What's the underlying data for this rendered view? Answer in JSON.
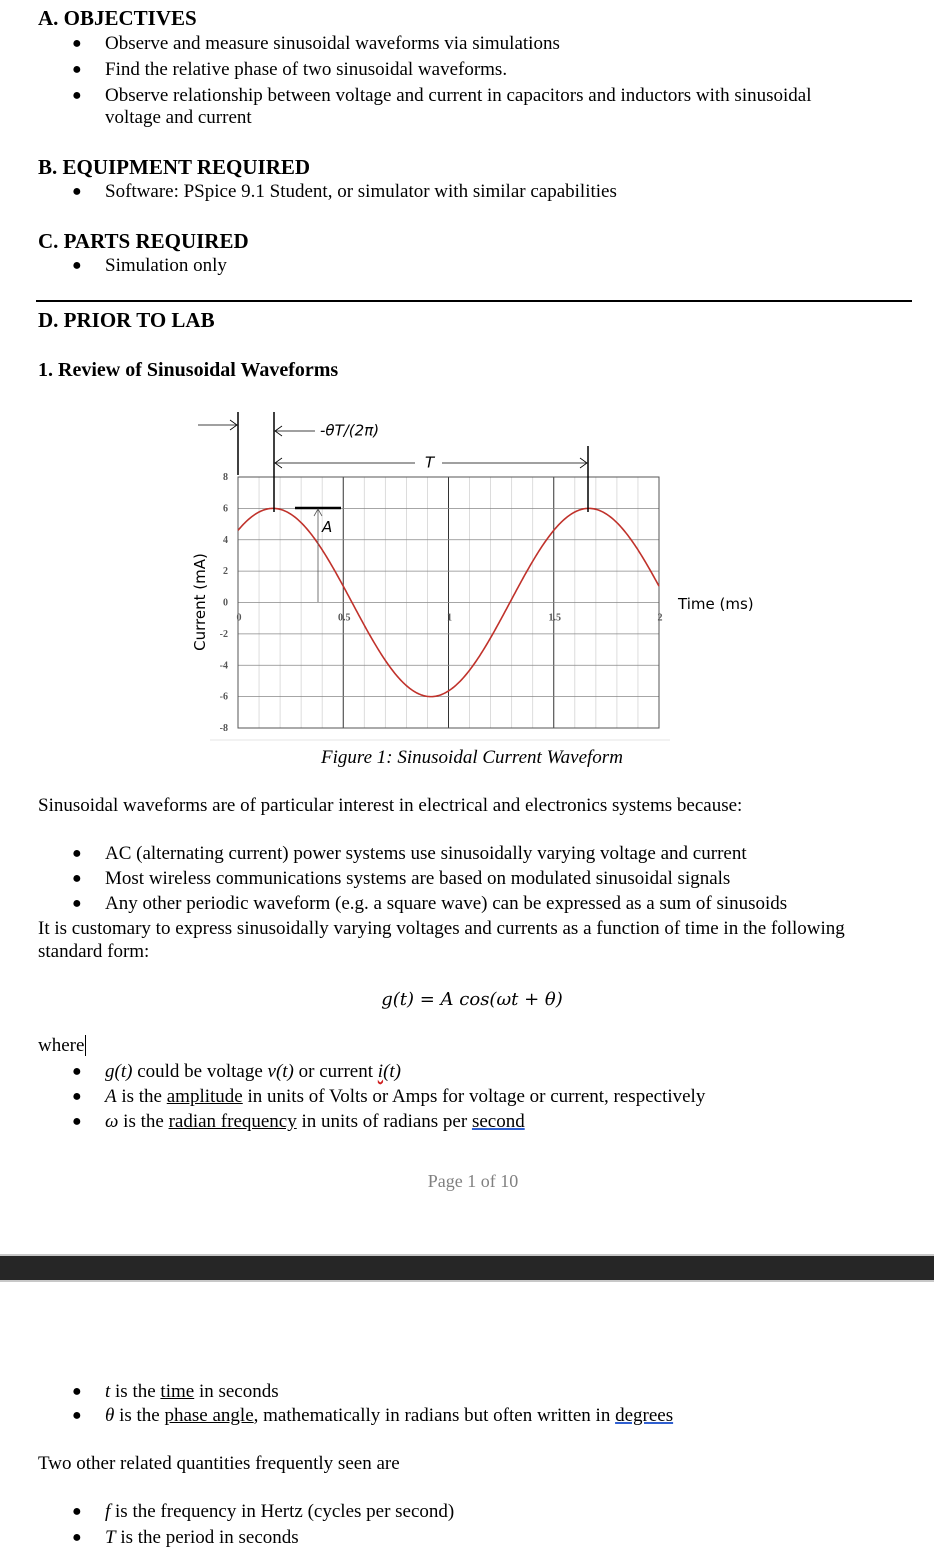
{
  "sections": {
    "a_title": "A. OBJECTIVES",
    "a_items": [
      "Observe and measure sinusoidal waveforms via simulations",
      "Find the relative phase of two sinusoidal waveforms.",
      "Observe relationship between voltage and current in capacitors and inductors with sinusoidal",
      "voltage and current"
    ],
    "b_title": "B.  EQUIPMENT REQUIRED",
    "b_items": [
      "Software:   PSpice 9.1 Student, or simulator with similar capabilities"
    ],
    "c_title": "C. PARTS REQUIRED",
    "c_items": [
      "Simulation only"
    ],
    "d_title": "D. PRIOR TO LAB",
    "sub1_title": "1. Review of Sinusoidal Waveforms"
  },
  "figure": {
    "caption": "Figure 1:   Sinusoidal Current Waveform"
  },
  "chart_data": {
    "type": "line",
    "xlabel": "Time (ms)",
    "ylabel": "Current (mA)",
    "xlim": [
      0,
      2
    ],
    "ylim": [
      -8,
      8
    ],
    "x_ticks": [
      "0",
      "0.5",
      "1",
      "1.5",
      "2"
    ],
    "y_ticks": [
      "8",
      "6",
      "4",
      "2",
      "0",
      "-2",
      "-4",
      "-6",
      "-8"
    ],
    "grid": true,
    "series_color": "#c0322b",
    "series": [
      {
        "amplitude_mA": 6,
        "period_ms": 1.5,
        "phase_deg": -40
      }
    ],
    "annotations": {
      "phase": "-θT/(2π)",
      "period": "T",
      "amplitude": "A"
    }
  },
  "body": {
    "intro": "Sinusoidal waveforms are of particular interest in electrical and electronics systems because:",
    "reasons": [
      "AC (alternating current) power systems use sinusoidally varying voltage and current",
      "Most wireless communications systems are based on modulated sinusoidal signals",
      "Any other periodic waveform (e.g. a square wave) can be expressed as a sum of sinusoids"
    ],
    "custom_1": "It is customary to express sinusoidally varying voltages and currents as a function of time in the following",
    "custom_2": "standard form:",
    "equation": "g(t) = A  cos(ωt + θ)",
    "where": "where",
    "w1": {
      "a": "g(t)",
      "b": " could be voltage ",
      "c": "v(t)",
      "d": " or current ",
      "e": "i",
      "f": "(t)"
    },
    "w2": {
      "a": "A",
      "b": " is the ",
      "c": "amplitude",
      "d": " in units of Volts or Amps for voltage or current, respectively"
    },
    "w3": {
      "a": "ω",
      "b": " is the ",
      "c": "radian frequency",
      "d": " in units of radians per ",
      "e": "second"
    },
    "page_num": "Page  1  of 10",
    "w4": {
      "a": "t",
      "b": " is the ",
      "c": "time",
      "d": " in seconds"
    },
    "w5": {
      "a": "θ",
      "b": " is the ",
      "c": "phase angle",
      "d": ", mathematically in radians but often written in ",
      "e": "degrees"
    },
    "related": "Two other related quantities frequently seen are",
    "w6": {
      "a": "f",
      "b": " is the frequency in Hertz (cycles per second)"
    },
    "w7": {
      "a": "T",
      "b": " is the period in seconds"
    }
  }
}
